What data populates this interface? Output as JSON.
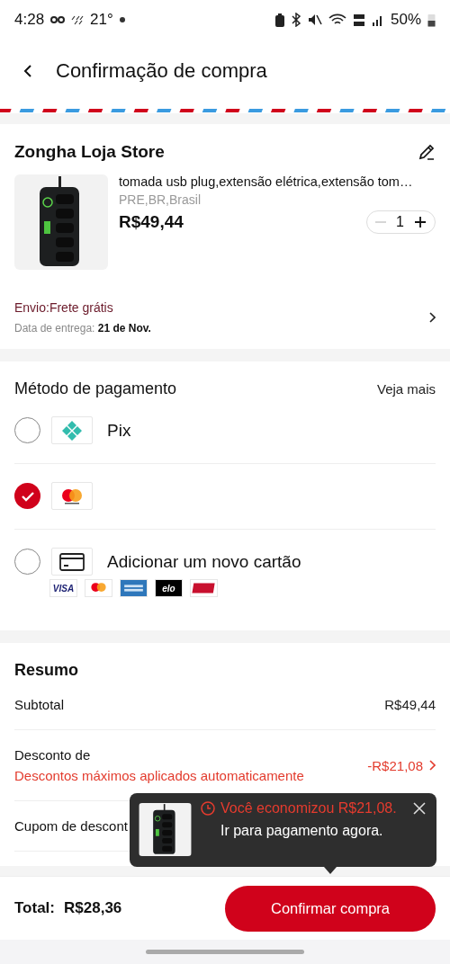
{
  "status_bar": {
    "time": "4:28",
    "temperature": "21°",
    "battery": "50%"
  },
  "header": {
    "title": "Confirmação de compra"
  },
  "store": {
    "name": "Zongha Loja Store",
    "product": {
      "kind": "picture",
      "title": "tomada usb plug,extensão elétrica,extensão tom…",
      "variant": "PRE,BR,Brasil",
      "price": "R$49,44",
      "quantity": "1",
      "can_decrease": false
    },
    "shipping": {
      "label": "Envio:Frete grátis",
      "delivery_label": "Data de entrega: ",
      "delivery_date": "21 de Nov."
    }
  },
  "payment": {
    "title": "Método de pagamento",
    "more": "Veja mais",
    "methods": [
      {
        "kind": "pix",
        "label": "Pix",
        "selected": false
      },
      {
        "kind": "mastercard",
        "selected": true
      },
      {
        "kind": "new_card",
        "label": "Adicionar um novo cartão",
        "selected": false,
        "brands": [
          {
            "kind": "visa",
            "label": "VISA"
          },
          {
            "kind": "mastercard"
          },
          {
            "kind": "amex"
          },
          {
            "kind": "elo",
            "label": "elo"
          },
          {
            "kind": "hipercard"
          }
        ]
      }
    ]
  },
  "summary": {
    "title": "Resumo",
    "rows": [
      {
        "kind": "plain",
        "label": "Subtotal",
        "value": "R$49,44"
      },
      {
        "kind": "discount",
        "label": "Desconto de",
        "note": "Descontos máximos aplicados automaticamente",
        "value": "-R$21,08"
      },
      {
        "kind": "link",
        "label": "Cupom de descont"
      }
    ]
  },
  "popup": {
    "headline": "Você economizou",
    "amount": "R$21,08.",
    "rest": "Ir para pagamento agora."
  },
  "footer": {
    "total_label": "Total:",
    "total": "R$28,36",
    "button": "Confirmar compra"
  }
}
